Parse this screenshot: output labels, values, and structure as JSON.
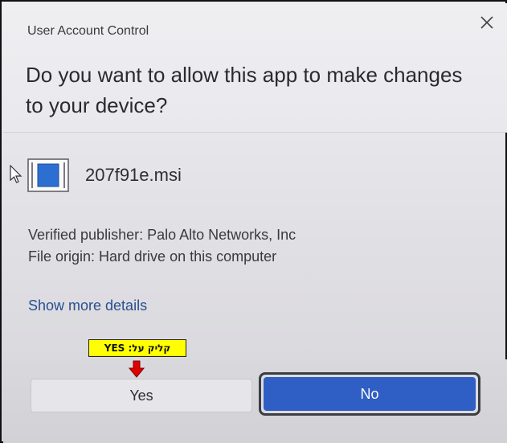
{
  "dialog": {
    "title": "User Account Control",
    "question": "Do you want to allow this app to make changes to your device?",
    "app_name": "207f91e.msi",
    "publisher": "Verified publisher: Palo Alto Networks, Inc",
    "origin": "File origin: Hard drive on this computer",
    "more_details": "Show more details"
  },
  "annotation": {
    "label": "קליק על:  YES"
  },
  "buttons": {
    "yes_label": "Yes",
    "no_label": "No"
  },
  "icons": [
    "close-icon",
    "cursor-icon",
    "installer-app-icon",
    "down-arrow-icon"
  ],
  "colors": {
    "no_button": "#2f5fc4",
    "link": "#2a4f8f",
    "annotation_bg": "#ffff00",
    "annotation_arrow": "#e10000"
  }
}
